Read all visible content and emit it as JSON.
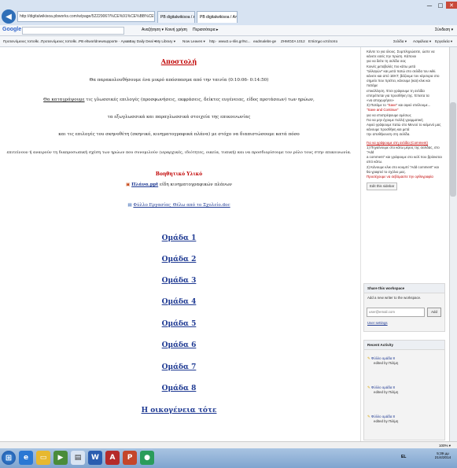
{
  "browser": {
    "back_glyph": "◀",
    "fwd_glyph": "▶",
    "address": "http://digitalwikisoa.pbworks.com/w/page/52229067/%CE%91%CE%BB%CE%B5%CE%BE%CE%B1%CE%BD%CE%B4%CF%81",
    "tabs": [
      "PB digitalwikisoa / Αποστολή",
      "PB digitalwikisoa / Αποστ..."
    ],
    "min": "—",
    "max": "□",
    "close": "✕",
    "search_logo": "Google",
    "search_toolbar": [
      "Αναζήτηση ▾",
      "Κοινή χρήση",
      "Περισσότερα ▸"
    ],
    "signin": "Σύνδεση ▾",
    "bookmarks": [
      "Προτεινόμενες τοποθε...",
      "Προτεινόμενες τοποθε...",
      "PB eltworldnewsupporte · Αγια...",
      "eBay Daily Deal ▾",
      "My Library ▾",
      "Now Leaves ▾",
      "http · www2.u-rilis.gr/Nc...",
      "eadmalebs-ge",
      "ZHMOZA 1012",
      "Επίσημο ιστότοπο"
    ],
    "menus": [
      "Σελίδα ▾",
      "Ασφάλεια ▾",
      "Εργαλεία ▾"
    ]
  },
  "main": {
    "title": "Αποστολή",
    "line1": "Θα παρακολουθήσουμε ένα μικρό απόσπασμα από την ταινία (0:10:06- 0:14:50)",
    "line2_link": "Θα καταγράψουμε",
    "line2_rest": " τις γλωσσικές επιλογές (προσφωνήσεις, εκφράσεις, δείκτες ευγένειας, είδος προτάσεων) των ηρώων,",
    "line3": "τα εξωγλωσσικά και παραγλωσσικά στοιχεία της επικοινωνίας",
    "line4": "και τις επιλογές του σκηνοθέτη (σκηνικό, κινηματογραφικά πλάνα) με στόχο να διαπιστώσουμε κατά πόσο",
    "line5": "επιτείνουν ή αναιρούν τη διαπροσωπική σχέση των ηρώων που συνομιλούν (ιεραρχικές, ιδιότητες, οικεία, τυπική) και να προσδιορίσουμε τον ρόλο τους στην επικοινωνία.",
    "material_title": "Βοηθητικό Υλικό",
    "material_link": "Πλάνα.ppt",
    "material_desc": " είδη κινηματογραφικών πλάνων",
    "sheet_link": "Φύλλο Εργασίας_Θέλω από το Σχολείο.doc",
    "groups": [
      "Ομάδα 1",
      "Ομάδα 2",
      "Ομάδα 3",
      "Ομάδα 4",
      "Ομάδα 5",
      "Ομάδα 6",
      "Ομάδα 7",
      "Ομάδα 8"
    ],
    "final_link": "Η οικογένεια τότε"
  },
  "sidebar": {
    "intro_lines": [
      "Κάντε το για όλους. Συμπληρώσετε, ώστε να",
      "κάνετε εσείς την πρώτη. Κάποιοι",
      "για να δείτε τη σελίδα σας",
      "Κοινές μεταβολές πιο κάτω μετά",
      "\"αλλαγών\" και μετά πατώ στο σελίδα του wiki.",
      "κάνετε και από 1ΕΚΤ, βάζουμε τον κέρσορα στο",
      "σημείο που πρέπει, κάνουμε (και) κλικ και πατάμε",
      "επικόλληση. Έτσι γράφουμε τη σελίδα",
      "επιτρέπεται για προσθήκη της. Έπειτα τα",
      "«να αποχωρήσει»"
    ],
    "save_line_1": "3) Πατάμε το \"",
    "save_word": "Save",
    "save_line_2": "\" και αφού στείλουμε...",
    "save_continue": "\"Save and Continue\"",
    "notes": [
      "για να επιστρέψουμε αμέσως",
      "Για να μην έχουμε πολλή γραμματική",
      "Αφού γράψουμε πατώ στο Μενού το κείμενό μας",
      "κάνουμε προσθήκη και μετά",
      "την αποθήκευση στη σελίδα."
    ],
    "comment_head": "Για να γράψουμε στη σελίδα (Comment)",
    "comment_lines": [
      "1) Πηγαίνουμε στο κάτω μέρος της σελίδας, στο \"Add",
      "a comment\" και γράφουμε στο κελί που βρίσκεται",
      "από κάτω.",
      "2) Κάνουμε κλικ στο κουμπί \"Add comment\" και",
      "θα γραφτεί το σχόλιο μας."
    ],
    "comment_note": "Προσέχουμε να σεβόμαστε την ορθογραφία",
    "edit_link": "Edit this sidebar",
    "share_title": "Share this workspace",
    "share_text": "Add a new writer to the workspace.",
    "email_placeholder": "user@email.com",
    "add_label": "Add",
    "user_settings": "User settings",
    "recent_title": "Recent Activity",
    "activity": [
      {
        "title": "Φύλλο ομάδα 8",
        "by": "edited by Πιλίμη"
      },
      {
        "title": "Φύλλο ομάδα 8",
        "by": "edited by Πιλίμη"
      },
      {
        "title": "Φύλλο ομάδα 8",
        "by": "edited by Πιλίμη"
      }
    ]
  },
  "status": {
    "zoom": "100% ▾"
  },
  "taskbar": {
    "start": "⊞",
    "clock_time": "5:39 μμ",
    "clock_date": "21/4/2014",
    "lang": "EL"
  },
  "colors": {
    "accent": "#1f3a93",
    "title_red": "#c00000"
  }
}
